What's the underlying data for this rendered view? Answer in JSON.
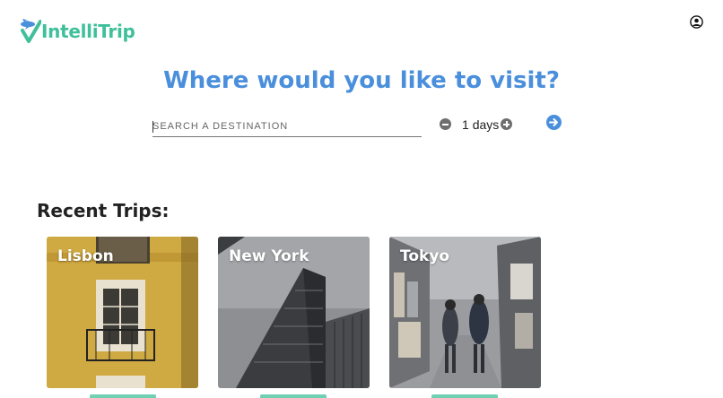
{
  "app": {
    "name": "IntelliTrip"
  },
  "header": {
    "profile_icon": "user-circle-icon"
  },
  "hero": {
    "title": "Where would you like to visit?"
  },
  "search": {
    "placeholder": "SEARCH A DESTINATION",
    "value": ""
  },
  "duration": {
    "value": "1",
    "unit": "days",
    "decrement_icon": "minus-circle-icon",
    "increment_icon": "plus-circle-icon"
  },
  "submit": {
    "icon": "arrow-right-circle-icon"
  },
  "recent": {
    "title": "Recent Trips:",
    "trips": [
      {
        "label": "Lisbon"
      },
      {
        "label": "New York"
      },
      {
        "label": "Tokyo"
      }
    ]
  },
  "colors": {
    "brand_green": "#3fbf9a",
    "accent_blue": "#4a8fdc"
  }
}
